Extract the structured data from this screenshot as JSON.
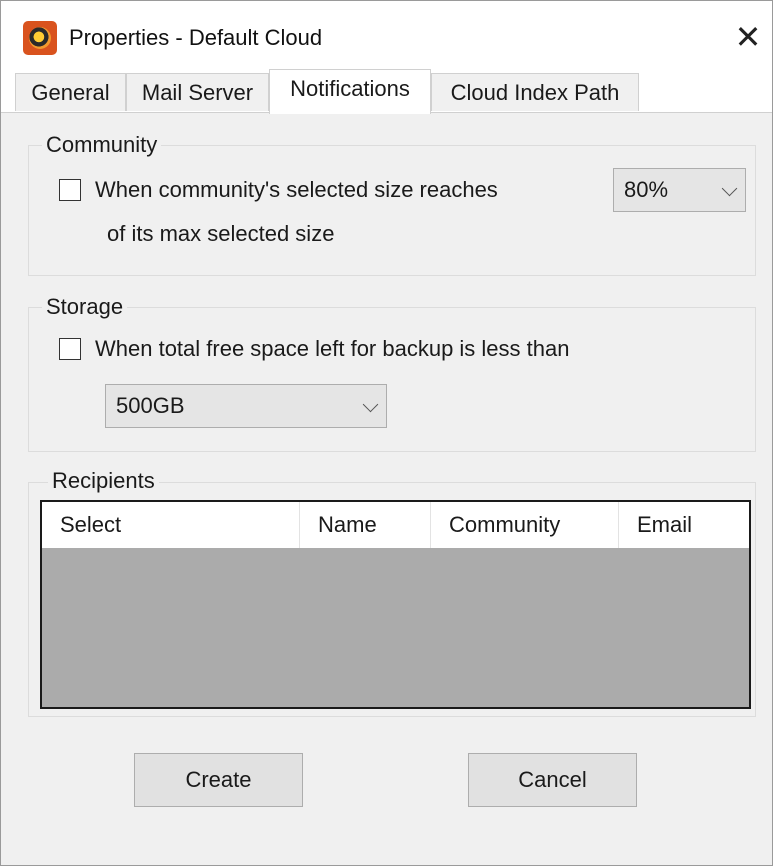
{
  "window": {
    "title": "Properties - Default Cloud"
  },
  "tabs": [
    {
      "label": "General"
    },
    {
      "label": "Mail Server"
    },
    {
      "label": "Notifications",
      "active": true
    },
    {
      "label": "Cloud Index Path"
    }
  ],
  "community": {
    "legend": "Community",
    "checkbox_checked": false,
    "label_line1": "When community's selected size reaches",
    "label_line2": "of its max selected size",
    "threshold_value": "80%"
  },
  "storage": {
    "legend": "Storage",
    "checkbox_checked": false,
    "label": "When total free space left for backup is less than",
    "threshold_value": "500GB"
  },
  "recipients": {
    "legend": "Recipients",
    "columns": [
      "Select",
      "Name",
      "Community",
      "Email"
    ],
    "rows": []
  },
  "buttons": {
    "create": "Create",
    "cancel": "Cancel"
  },
  "icons": {
    "app": "app-logo-icon",
    "close": "close-icon",
    "chevron": "chevron-down-icon"
  }
}
